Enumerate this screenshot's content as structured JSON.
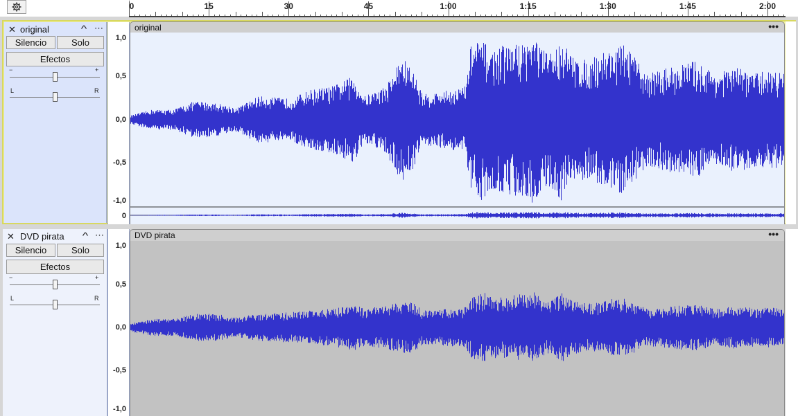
{
  "ruler": {
    "ticks": [
      {
        "label": "0",
        "sec": 0
      },
      {
        "label": "15",
        "sec": 15
      },
      {
        "label": "30",
        "sec": 30
      },
      {
        "label": "45",
        "sec": 45
      },
      {
        "label": "1:00",
        "sec": 60
      },
      {
        "label": "1:15",
        "sec": 75
      },
      {
        "label": "1:30",
        "sec": 90
      },
      {
        "label": "1:45",
        "sec": 105
      },
      {
        "label": "2:00",
        "sec": 120
      }
    ],
    "settings_icon": "gear-icon"
  },
  "tracks": [
    {
      "name": "original",
      "mute_label": "Silencio",
      "solo_label": "Solo",
      "effects_label": "Efectos",
      "gain_minus": "−",
      "gain_plus": "+",
      "pan_left": "L",
      "pan_right": "R",
      "clip_title": "original",
      "scale_labels": [
        "1,0",
        "0,5",
        "0,0",
        "-0,5",
        "-1,0"
      ],
      "bottom_label": "0",
      "selected": true,
      "wave_color": "#3333cc"
    },
    {
      "name": "DVD pirata",
      "mute_label": "Silencio",
      "solo_label": "Solo",
      "effects_label": "Efectos",
      "gain_minus": "−",
      "gain_plus": "+",
      "pan_left": "L",
      "pan_right": "R",
      "clip_title": "DVD pirata",
      "scale_labels": [
        "1,0",
        "0,5",
        "0,0",
        "-0,5",
        "-1,0"
      ],
      "selected": false,
      "wave_color": "#3333cc"
    }
  ],
  "menu_glyph": "⋯",
  "collapse_glyph": "^",
  "close_glyph": "✕",
  "clip_menu_glyph": "•••",
  "envelopes": {
    "original": [
      [
        0,
        0.05
      ],
      [
        4,
        0.12
      ],
      [
        8,
        0.12
      ],
      [
        12,
        0.22
      ],
      [
        16,
        0.2
      ],
      [
        20,
        0.14
      ],
      [
        24,
        0.28
      ],
      [
        30,
        0.25
      ],
      [
        34,
        0.36
      ],
      [
        38,
        0.4
      ],
      [
        42,
        0.52
      ],
      [
        44,
        0.28
      ],
      [
        48,
        0.4
      ],
      [
        51,
        0.75
      ],
      [
        53,
        0.6
      ],
      [
        55,
        0.3
      ],
      [
        60,
        0.35
      ],
      [
        63,
        0.4
      ],
      [
        64,
        0.9
      ],
      [
        66,
        0.95
      ],
      [
        68,
        0.82
      ],
      [
        70,
        0.88
      ],
      [
        72,
        0.9
      ],
      [
        74,
        0.92
      ],
      [
        76,
        1.0
      ],
      [
        78,
        0.8
      ],
      [
        80,
        0.85
      ],
      [
        81,
        0.98
      ],
      [
        83,
        0.75
      ],
      [
        86,
        0.7
      ],
      [
        89,
        0.82
      ],
      [
        91,
        0.85
      ],
      [
        93,
        0.9
      ],
      [
        95,
        0.72
      ],
      [
        97,
        0.55
      ],
      [
        100,
        0.6
      ],
      [
        103,
        0.65
      ],
      [
        106,
        0.7
      ],
      [
        110,
        0.55
      ],
      [
        114,
        0.62
      ],
      [
        118,
        0.55
      ],
      [
        120,
        0.6
      ],
      [
        123,
        0.55
      ]
    ],
    "dvd": [
      [
        0,
        0.05
      ],
      [
        4,
        0.1
      ],
      [
        8,
        0.1
      ],
      [
        12,
        0.16
      ],
      [
        16,
        0.16
      ],
      [
        20,
        0.12
      ],
      [
        24,
        0.16
      ],
      [
        30,
        0.18
      ],
      [
        34,
        0.2
      ],
      [
        38,
        0.22
      ],
      [
        42,
        0.28
      ],
      [
        44,
        0.22
      ],
      [
        48,
        0.26
      ],
      [
        51,
        0.3
      ],
      [
        53,
        0.3
      ],
      [
        55,
        0.2
      ],
      [
        60,
        0.22
      ],
      [
        63,
        0.24
      ],
      [
        64,
        0.35
      ],
      [
        66,
        0.42
      ],
      [
        68,
        0.38
      ],
      [
        70,
        0.36
      ],
      [
        72,
        0.38
      ],
      [
        74,
        0.4
      ],
      [
        76,
        0.42
      ],
      [
        78,
        0.32
      ],
      [
        80,
        0.36
      ],
      [
        81,
        0.42
      ],
      [
        83,
        0.32
      ],
      [
        86,
        0.28
      ],
      [
        89,
        0.32
      ],
      [
        91,
        0.34
      ],
      [
        93,
        0.35
      ],
      [
        95,
        0.3
      ],
      [
        97,
        0.22
      ],
      [
        100,
        0.24
      ],
      [
        103,
        0.26
      ],
      [
        106,
        0.28
      ],
      [
        110,
        0.22
      ],
      [
        114,
        0.26
      ],
      [
        118,
        0.22
      ],
      [
        120,
        0.24
      ],
      [
        123,
        0.22
      ]
    ]
  },
  "timeline": {
    "duration_sec": 123
  }
}
